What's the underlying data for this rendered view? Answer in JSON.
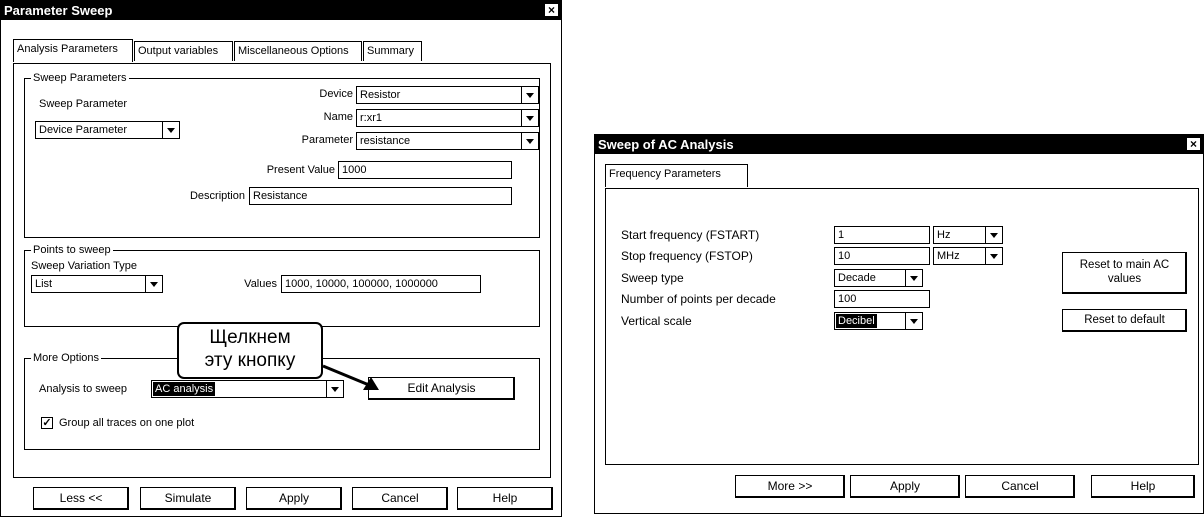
{
  "param_sweep": {
    "title": "Parameter Sweep",
    "close_glyph": "×",
    "tabs": [
      "Analysis Parameters",
      "Output variables",
      "Miscellaneous Options",
      "Summary"
    ],
    "sweep_group": {
      "legend": "Sweep Parameters",
      "sweep_parameter_label": "Sweep Parameter",
      "sweep_parameter_value": "Device Parameter",
      "device_label": "Device",
      "device_value": "Resistor",
      "name_label": "Name",
      "name_value": "r:xr1",
      "parameter_label": "Parameter",
      "parameter_value": "resistance",
      "present_value_label": "Present Value",
      "present_value": "1000",
      "description_label": "Description",
      "description_value": "Resistance"
    },
    "points_group": {
      "legend": "Points to sweep",
      "variation_label": "Sweep Variation Type",
      "variation_value": "List",
      "values_label": "Values",
      "values_value": "1000, 10000, 100000, 1000000"
    },
    "more_group": {
      "legend": "More Options",
      "analysis_label": "Analysis to sweep",
      "analysis_value": "AC analysis",
      "edit_button": "Edit Analysis",
      "group_traces_label": "Group all traces on one plot",
      "group_traces_checked": true
    },
    "buttons": {
      "less": "Less <<",
      "simulate": "Simulate",
      "apply": "Apply",
      "cancel": "Cancel",
      "help": "Help"
    },
    "callout_text": [
      "Щелкнем",
      "эту кнопку"
    ]
  },
  "ac_sweep": {
    "title": "Sweep of AC Analysis",
    "close_glyph": "×",
    "tab": "Frequency Parameters",
    "start_label": "Start frequency (FSTART)",
    "start_value": "1",
    "start_unit": "Hz",
    "stop_label": "Stop frequency (FSTOP)",
    "stop_value": "10",
    "stop_unit": "MHz",
    "sweep_type_label": "Sweep type",
    "sweep_type_value": "Decade",
    "points_label": "Number of points per decade",
    "points_value": "100",
    "vscale_label": "Vertical scale",
    "vscale_value": "Decibel",
    "reset_main_line1": "Reset to main AC",
    "reset_main_line2": "values",
    "reset_default": "Reset to default",
    "buttons": {
      "more": "More >>",
      "apply": "Apply",
      "cancel": "Cancel",
      "help": "Help"
    }
  }
}
